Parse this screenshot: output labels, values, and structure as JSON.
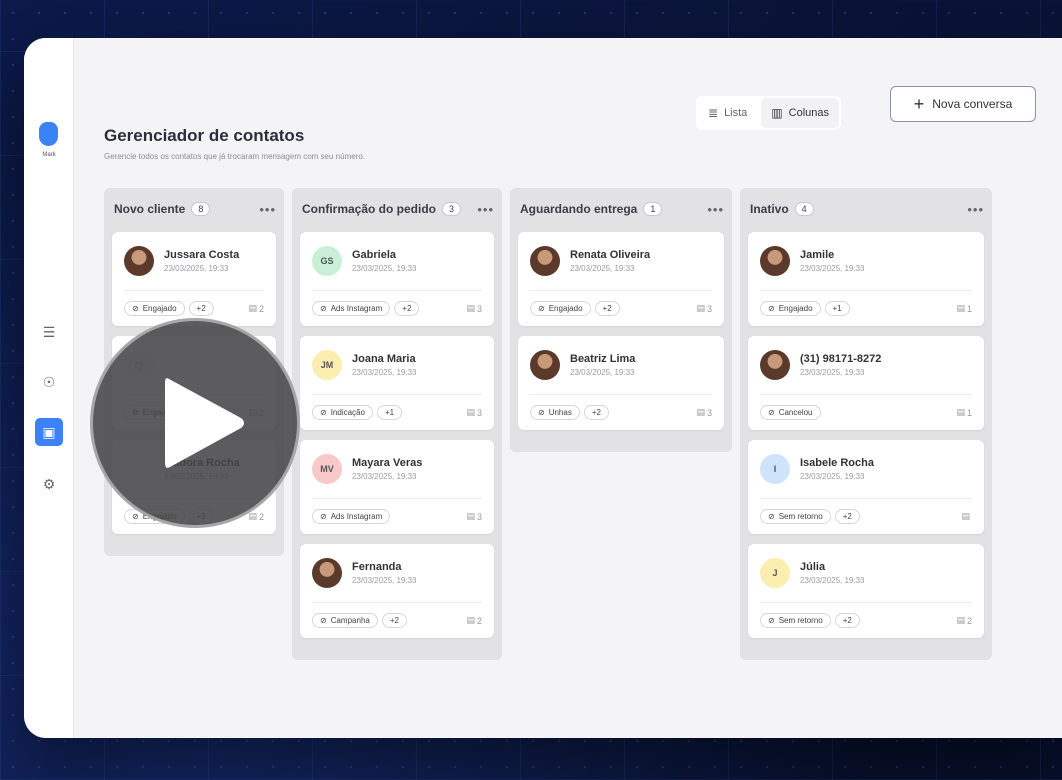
{
  "app": {
    "logo_label": "Mark"
  },
  "header": {
    "title": "Gerenciador de contatos",
    "subtitle": "Gerencie todos os contatos que já trocaram mensagem com seu número."
  },
  "view_toggle": {
    "list_label": "Lista",
    "columns_label": "Colunas",
    "active": "Colunas"
  },
  "new_button": {
    "label": "Nova conversa"
  },
  "columns": [
    {
      "title": "Novo cliente",
      "count": "8",
      "cards": [
        {
          "name": "Jussara Costa",
          "date": "23/03/2025, 19:33",
          "avatar": "photo",
          "tag": "Engajado",
          "more": "+2",
          "files": "2"
        },
        {
          "name": "",
          "date": "",
          "avatar": "generic",
          "tag": "Engajado",
          "more": "",
          "files": "2"
        },
        {
          "name": "Isadora Rocha",
          "date": "23/03/2025, 19:33",
          "avatar": "none",
          "tag": "Engajado",
          "more": "+2",
          "files": "2"
        }
      ]
    },
    {
      "title": "Confirmação do pedido",
      "count": "3",
      "cards": [
        {
          "name": "Gabriela",
          "date": "23/03/2025, 19:33",
          "avatar": "initials",
          "initials": "GS",
          "tag": "Ads Instagram",
          "more": "+2",
          "files": "3"
        },
        {
          "name": "Joana Maria",
          "date": "23/03/2025, 19:33",
          "avatar": "initials",
          "initials": "JM",
          "tag": "Indicação",
          "more": "+1",
          "files": "3"
        },
        {
          "name": "Mayara Veras",
          "date": "23/03/2025, 19:33",
          "avatar": "initials",
          "initials": "MV",
          "tag": "Ads Instagram",
          "more": "",
          "files": "3"
        },
        {
          "name": "Fernanda",
          "date": "23/03/2025, 19:33",
          "avatar": "photo",
          "tag": "Campanha",
          "more": "+2",
          "files": "2"
        }
      ]
    },
    {
      "title": "Aguardando entrega",
      "count": "1",
      "cards": [
        {
          "name": "Renata Oliveira",
          "date": "23/03/2025, 19:33",
          "avatar": "photo",
          "tag": "Engajado",
          "more": "+2",
          "files": "3"
        },
        {
          "name": "Beatriz Lima",
          "date": "23/03/2025, 19:33",
          "avatar": "photo",
          "tag": "Unhas",
          "more": "+2",
          "files": "3"
        }
      ]
    },
    {
      "title": "Inativo",
      "count": "4",
      "cards": [
        {
          "name": "Jamile",
          "date": "23/03/2025, 19:33",
          "avatar": "photo",
          "tag": "Engajado",
          "more": "+1",
          "files": "1"
        },
        {
          "name": "(31) 98171-8272",
          "date": "23/03/2025, 19:33",
          "avatar": "photo",
          "tag": "Cancelou",
          "more": "",
          "files": "1"
        },
        {
          "name": "Isabele Rocha",
          "date": "23/03/2025, 19:33",
          "avatar": "initials",
          "initials": "I",
          "tag": "Sem retorno",
          "more": "+2",
          "files": ""
        },
        {
          "name": "Júlia",
          "date": "23/03/2025, 19:33",
          "avatar": "initials",
          "initials": "J",
          "tag": "Sem retorno",
          "more": "+2",
          "files": "2"
        }
      ]
    }
  ],
  "colors": {
    "accent": "#3b82f6",
    "gs": "#c9f0d6",
    "jm": "#fbeeb0",
    "mv": "#f8c9c9",
    "i": "#cfe3fb",
    "j": "#fbeeb0"
  }
}
